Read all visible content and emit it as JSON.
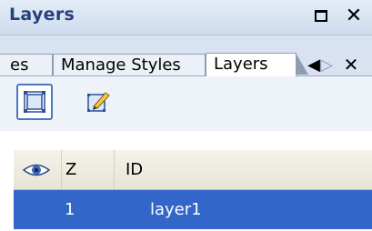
{
  "window": {
    "title": "Layers",
    "maximize_icon": "maximize-icon",
    "close_symbol": "✕"
  },
  "tabs": [
    {
      "label": "es",
      "active": false
    },
    {
      "label": "Manage Styles",
      "active": false
    },
    {
      "label": "Layers",
      "active": true
    }
  ],
  "tab_nav": {
    "prev": "◀",
    "next": "▷",
    "close": "✕"
  },
  "toolbar": {
    "select_tool_icon": "select-layer-icon",
    "edit_tool_icon": "edit-layer-icon"
  },
  "grid": {
    "columns": [
      {
        "key": "visible",
        "icon": "eye-icon"
      },
      {
        "key": "z",
        "label": "Z"
      },
      {
        "key": "id",
        "label": "ID"
      }
    ],
    "rows": [
      {
        "z": "1",
        "id": "layer1",
        "selected": true
      }
    ]
  },
  "colors": {
    "title_text": "#27427a",
    "selection": "#3266c8"
  }
}
